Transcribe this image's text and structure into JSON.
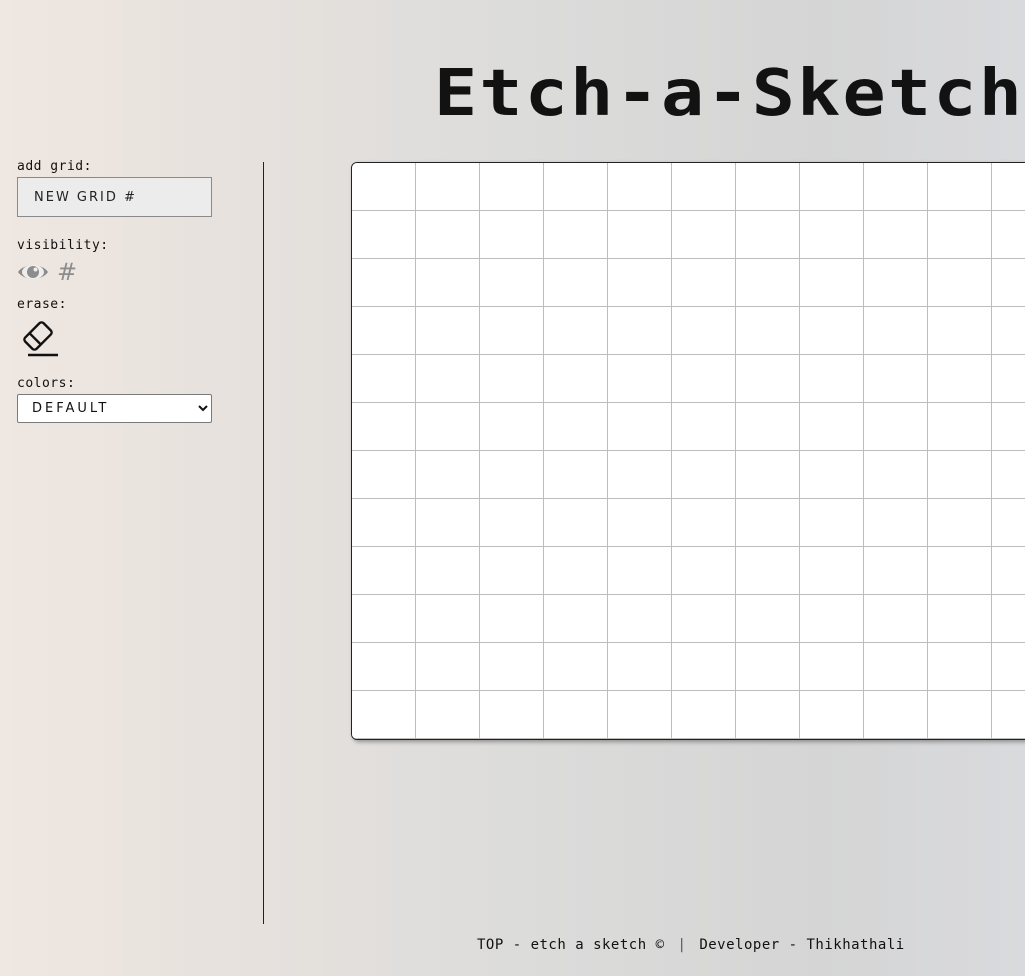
{
  "header": {
    "title": "Etch-a-Sketch"
  },
  "sidebar": {
    "add_grid_label": "add grid:",
    "grid_input_placeholder": "NEW GRID #",
    "visibility_label": "visibility:",
    "visibility_hash": "#",
    "erase_label": "erase:",
    "colors_label": "colors:",
    "colors_options": [
      "DEFAULT"
    ],
    "colors_selected": "DEFAULT"
  },
  "board": {
    "columns": 11,
    "rows": 12
  },
  "footer": {
    "left": "TOP - etch a sketch ©",
    "separator": "|",
    "right": "Developer - Thikhathali"
  },
  "colors": {
    "cell_border": "#bdbdbd",
    "board_background": "#ffffff",
    "eye_icon": "#8c8c8c"
  }
}
